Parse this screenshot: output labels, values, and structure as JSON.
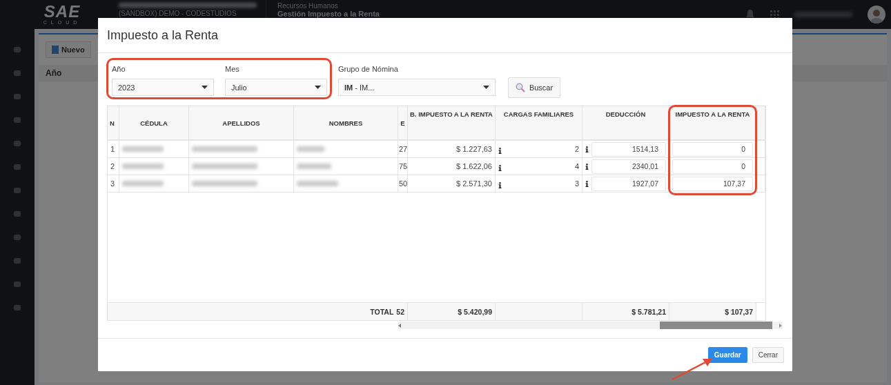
{
  "app": {
    "logo": "SAE",
    "logo_sub": "CLOUD",
    "company": "(SANDBOX) DEMO - CODESTUDIOS",
    "module": "Recursos Humanos",
    "page_title": "Gestión Impuesto a la Renta"
  },
  "background": {
    "new_button": "Nuevo",
    "grid_column": "Año"
  },
  "dialog": {
    "title": "Impuesto a la Renta",
    "filters": [
      {
        "label": "Año",
        "value": "2023"
      },
      {
        "label": "Mes",
        "value": "Julio"
      },
      {
        "label": "Grupo de Nómina",
        "value": "**IM** - IM..."
      }
    ],
    "search_button": "Buscar",
    "table": {
      "columns": [
        "N",
        "CÉDULA",
        "APELLIDOS",
        "NOMBRES",
        "E",
        "B. IMPUESTO A LA RENTA",
        "CARGAS FAMILIARES",
        "DEDUCCIÓN",
        "IMPUESTO A LA RENTA"
      ],
      "rows": [
        {
          "n": "1",
          "column_5": "27",
          "base": "$ 1.227,63",
          "cargas": "2",
          "deduccion": "1514,13",
          "impuesto": "0"
        },
        {
          "n": "2",
          "column_5": "75",
          "base": "$ 1.622,06",
          "cargas": "4",
          "deduccion": "2340,01",
          "impuesto": "0"
        },
        {
          "n": "3",
          "column_5": "50",
          "base": "$ 2.571,30",
          "cargas": "3",
          "deduccion": "1927,07",
          "impuesto": "107,37"
        }
      ],
      "totals": {
        "label": "TOTAL",
        "column_5": "52",
        "base": "$ 5.420,99",
        "deduccion": "$ 5.781,21",
        "impuesto": "$ 107,37"
      }
    },
    "buttons": [
      {
        "label": "Guardar",
        "kind": "primary"
      },
      {
        "label": "Cerrar",
        "kind": "secondary"
      }
    ]
  }
}
